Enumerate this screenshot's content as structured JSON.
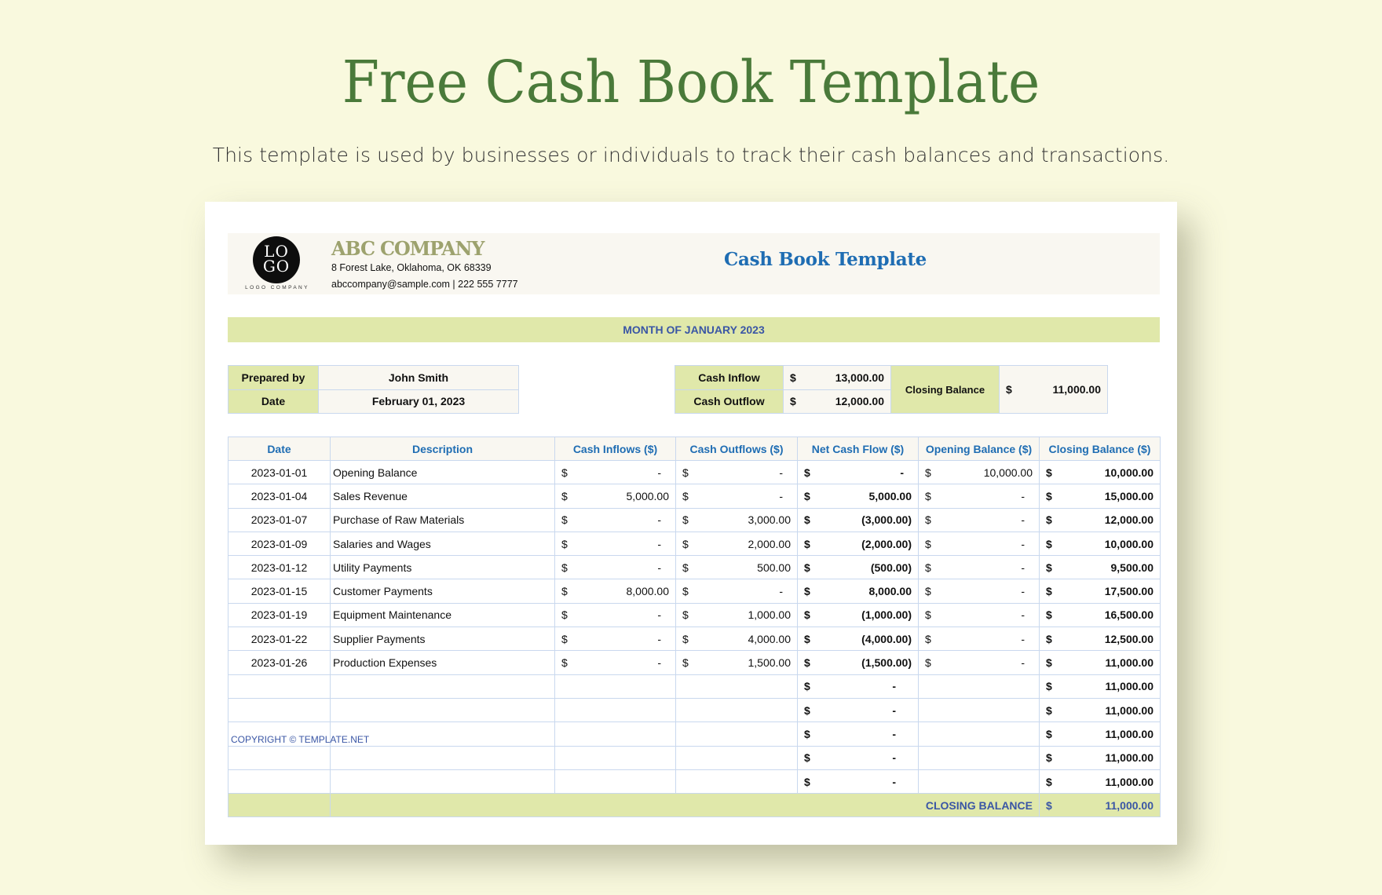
{
  "page": {
    "title": "Free Cash Book Template",
    "subtitle": "This template is used by businesses or individuals to track their cash balances and transactions."
  },
  "header": {
    "logo_text_line1": "LO",
    "logo_text_line2": "GO",
    "logo_caption": "LOGO COMPANY",
    "company_name": "ABC COMPANY",
    "address": "8 Forest Lake, Oklahoma, OK 68339",
    "contact": "abccompany@sample.com |  222 555 7777",
    "doc_title": "Cash Book Template"
  },
  "month_label": "MONTH OF JANUARY 2023",
  "info": {
    "prepared_by_label": "Prepared by",
    "prepared_by_value": "John Smith",
    "date_label": "Date",
    "date_value": "February 01, 2023"
  },
  "summary": {
    "currency": "$",
    "cash_inflow_label": "Cash Inflow",
    "cash_inflow_value": "13,000.00",
    "cash_outflow_label": "Cash Outflow",
    "cash_outflow_value": "12,000.00",
    "closing_balance_label": "Closing Balance",
    "closing_balance_value": "11,000.00"
  },
  "table": {
    "columns": [
      "Date",
      "Description",
      "Cash Inflows ($)",
      "Cash Outflows ($)",
      "Net Cash Flow ($)",
      "Opening Balance ($)",
      "Closing Balance ($)"
    ],
    "rows": [
      {
        "date": "2023-01-01",
        "description": "Opening Balance",
        "inflow": "-",
        "outflow": "-",
        "net": "-",
        "opening": "10,000.00",
        "closing": "10,000.00"
      },
      {
        "date": "2023-01-04",
        "description": "Sales Revenue",
        "inflow": "5,000.00",
        "outflow": "-",
        "net": "5,000.00",
        "opening": "-",
        "closing": "15,000.00"
      },
      {
        "date": "2023-01-07",
        "description": "Purchase of Raw Materials",
        "inflow": "-",
        "outflow": "3,000.00",
        "net": "(3,000.00)",
        "opening": "-",
        "closing": "12,000.00"
      },
      {
        "date": "2023-01-09",
        "description": "Salaries and Wages",
        "inflow": "-",
        "outflow": "2,000.00",
        "net": "(2,000.00)",
        "opening": "-",
        "closing": "10,000.00"
      },
      {
        "date": "2023-01-12",
        "description": "Utility Payments",
        "inflow": "-",
        "outflow": "500.00",
        "net": "(500.00)",
        "opening": "-",
        "closing": "9,500.00"
      },
      {
        "date": "2023-01-15",
        "description": "Customer Payments",
        "inflow": "8,000.00",
        "outflow": "-",
        "net": "8,000.00",
        "opening": "-",
        "closing": "17,500.00"
      },
      {
        "date": "2023-01-19",
        "description": "Equipment Maintenance",
        "inflow": "-",
        "outflow": "1,000.00",
        "net": "(1,000.00)",
        "opening": "-",
        "closing": "16,500.00"
      },
      {
        "date": "2023-01-22",
        "description": "Supplier Payments",
        "inflow": "-",
        "outflow": "4,000.00",
        "net": "(4,000.00)",
        "opening": "-",
        "closing": "12,500.00"
      },
      {
        "date": "2023-01-26",
        "description": "Production Expenses",
        "inflow": "-",
        "outflow": "1,500.00",
        "net": "(1,500.00)",
        "opening": "-",
        "closing": "11,000.00"
      },
      {
        "date": "",
        "description": "",
        "inflow": null,
        "outflow": null,
        "net": "-",
        "opening": null,
        "closing": "11,000.00"
      },
      {
        "date": "",
        "description": "",
        "inflow": null,
        "outflow": null,
        "net": "-",
        "opening": null,
        "closing": "11,000.00"
      },
      {
        "date": "",
        "description": "",
        "inflow": null,
        "outflow": null,
        "net": "-",
        "opening": null,
        "closing": "11,000.00"
      },
      {
        "date": "",
        "description": "",
        "inflow": null,
        "outflow": null,
        "net": "-",
        "opening": null,
        "closing": "11,000.00"
      },
      {
        "date": "",
        "description": "",
        "inflow": null,
        "outflow": null,
        "net": "-",
        "opening": null,
        "closing": "11,000.00"
      }
    ],
    "total_label": "CLOSING BALANCE",
    "total_currency": "$",
    "total_value": "11,000.00"
  },
  "footer": {
    "copyright": "COPYRIGHT © TEMPLATE.NET"
  },
  "colors": {
    "background": "#f9f9de",
    "title_green": "#4a7a3a",
    "accent_green": "#e0e8aa",
    "header_blue": "#1f6db3",
    "label_blue": "#3a56a5",
    "company_olive": "#9da26e"
  }
}
